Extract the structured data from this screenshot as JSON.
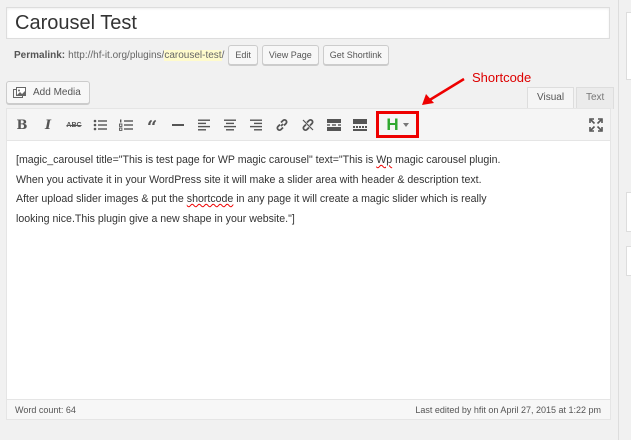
{
  "post": {
    "title": "Carousel Test"
  },
  "permalink": {
    "label": "Permalink:",
    "url_prefix": "http://hf-it.org/plugins/",
    "slug": "carousel-test",
    "url_suffix": "/",
    "buttons": {
      "edit": "Edit",
      "view": "View Page",
      "shortlink": "Get Shortlink"
    }
  },
  "media": {
    "add_media_label": "Add Media"
  },
  "annotation": {
    "label": "Shortcode",
    "color": "#dd0000"
  },
  "editor_tabs": {
    "visual": "Visual",
    "text": "Text"
  },
  "toolbar": {
    "bold": "B",
    "italic": "I",
    "strikethrough": "ABC",
    "blockquote": "“",
    "shortcode_button": "H",
    "shortcode_color": "#2fa82f",
    "icons": [
      "bold-icon",
      "italic-icon",
      "strikethrough-icon",
      "bulleted-list-icon",
      "numbered-list-icon",
      "blockquote-icon",
      "horizontal-line-icon",
      "align-left-icon",
      "align-center-icon",
      "align-right-icon",
      "link-icon",
      "unlink-icon",
      "read-more-icon",
      "toolbar-toggle-icon",
      "shortcode-icon",
      "fullscreen-icon"
    ]
  },
  "content": {
    "line1_a": "[magic_carousel title=\"This is test page for WP magic carousel\" text=\"This is ",
    "line1_spell": "Wp",
    "line1_b": " magic carousel plugin.",
    "line2": "When you activate it in your WordPress site it will make a slider area with header & description text.",
    "line3_a": "After upload slider images & put the ",
    "line3_spell": "shortcode",
    "line3_b": " in any page it will create a magic slider which is really",
    "line4": "looking nice.This plugin give a new shape in your website.\"]"
  },
  "status": {
    "word_count": "Word count: 64",
    "last_edited": "Last edited by hfit on April 27, 2015 at 1:22 pm"
  }
}
